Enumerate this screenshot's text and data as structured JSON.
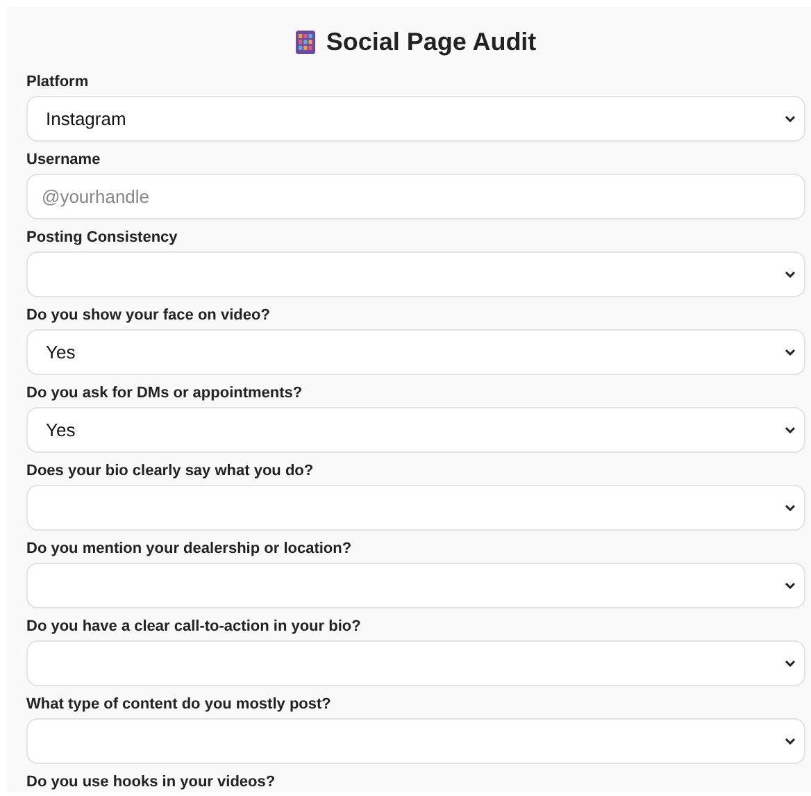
{
  "title": "Social Page Audit",
  "fields": [
    {
      "kind": "select",
      "label": "Platform",
      "value": "Instagram"
    },
    {
      "kind": "text",
      "label": "Username",
      "placeholder": "@yourhandle"
    },
    {
      "kind": "select",
      "label": "Posting Consistency"
    },
    {
      "kind": "select",
      "label": "Do you show your face on video?",
      "value": "Yes"
    },
    {
      "kind": "select",
      "label": "Do you ask for DMs or appointments?",
      "value": "Yes"
    },
    {
      "kind": "select",
      "label": "Does your bio clearly say what you do?"
    },
    {
      "kind": "select",
      "label": "Do you mention your dealership or location?"
    },
    {
      "kind": "select",
      "label": "Do you have a clear call-to-action in your bio?"
    },
    {
      "kind": "select",
      "label": "What type of content do you mostly post?"
    },
    {
      "kind": "label",
      "label": "Do you use hooks in your videos?"
    }
  ]
}
